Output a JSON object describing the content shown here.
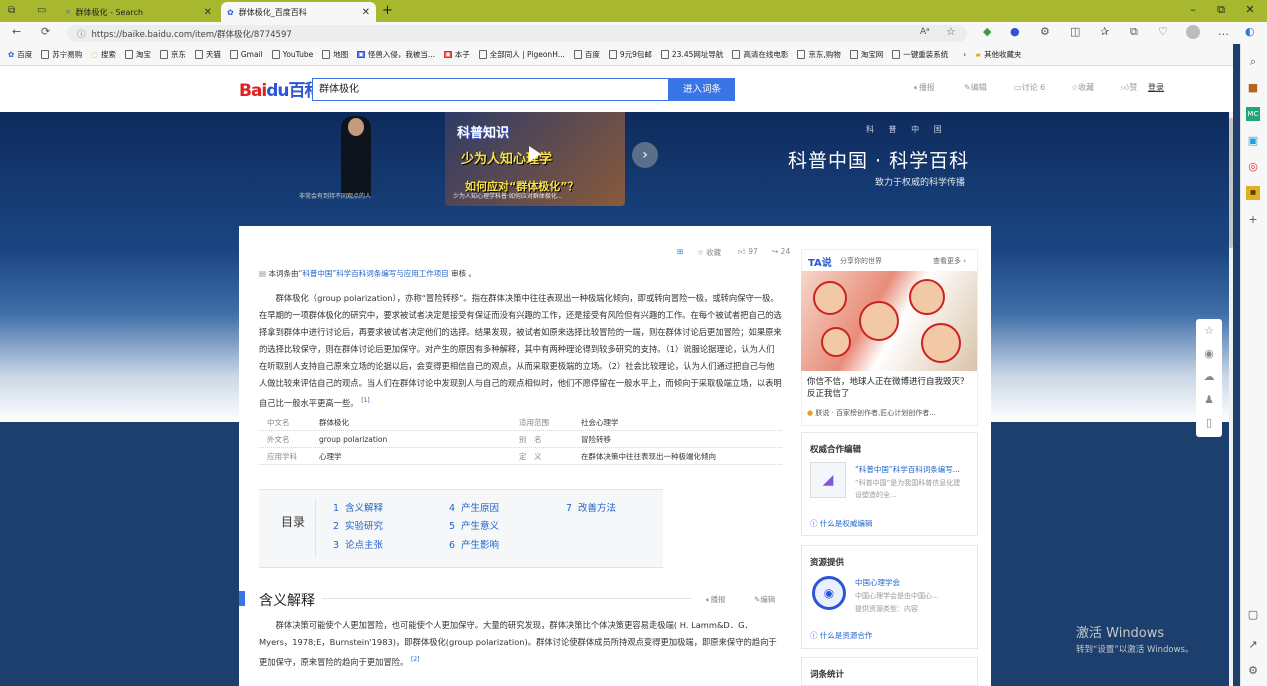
{
  "browser": {
    "tabs": [
      {
        "label": "群体极化 - Search",
        "active": false
      },
      {
        "label": "群体极化_百度百科",
        "active": true
      }
    ],
    "url": "https://baike.baidu.com/item/群体极化/8774597",
    "bookmarks": [
      "百度",
      "苏宁易购",
      "搜索",
      "淘宝",
      "京东",
      "天猫",
      "Gmail",
      "YouTube",
      "地图",
      "怪兽入侵，我被当...",
      "本子",
      "全部同人 | PigeonH...",
      "百度",
      "9元9包邮",
      "23.45网址导航",
      "高清在线电影",
      "京东,购物",
      "淘宝网",
      "一键重装系统"
    ],
    "bookmarks_more": "其他收藏夹"
  },
  "header": {
    "logo_bai": "Bai",
    "logo_du": "du百科",
    "search_value": "群体极化",
    "search_button": "进入词条",
    "actions": [
      "播报",
      "编辑",
      "讨论 6",
      "收藏",
      "赞"
    ],
    "login": "登录"
  },
  "banner": {
    "video1_caption": "非常会有到持不同观点的人",
    "video2_title1": "科普知识",
    "video2_title2": "少为人知心理学",
    "video2_title3": "如何应对“群体极化”？",
    "video2_caption": "少为人知心理学科普·如何应对群体极化...",
    "sci_logo": "科 普 中 国",
    "sci_title": "科普中国 · 科学百科",
    "sci_sub": "致力于权威的科学传播"
  },
  "article": {
    "stats": {
      "collect": "收藏",
      "likes": "97",
      "shares": "24"
    },
    "reviewer_prefix": "本词条由",
    "reviewer_link": "“科普中国”科学百科词条编写与应用工作项目",
    "reviewer_suffix": " 审核 。",
    "summary": "群体极化（group polarization），亦称“冒险转移”。指在群体决策中往往表现出一种极端化倾向，即或转向冒险一极，或转向保守一极。在早期的一项群体极化的研究中，要求被试者决定是接受有保证而没有兴趣的工作，还是接受有风险但有兴趣的工作。在每个被试者把自己的选择拿到群体中进行讨论后，再要求被试者决定他们的选择。结果发现，被试者如原来选择比较冒险的一端，则在群体讨论后更加冒险；如果原来的选择比较保守，则在群体讨论后更加保守。对产生的原因有多种解释，其中有两种理论得到较多研究的支持。（1）说服论据理论，认为人们在听取别人支持自己原来立场的论据以后，会变得更相信自己的观点，从而采取更极端的立场。（2）社会比较理论，认为人们通过把自己与他人做比较来评估自己的观点。当人们在群体讨论中发现别人与自己的观点相似时，他们不愿停留在一般水平上，而倾向于采取极端立场，以表明自己比一般水平更高一些。",
    "summary_ref": "[1]",
    "infobox": [
      {
        "k1": "中文名",
        "v1": "群体极化",
        "k2": "适用范围",
        "v2": "社会心理学"
      },
      {
        "k1": "外文名",
        "v1": "group polarization",
        "k2": "别　名",
        "v2": "冒险转移"
      },
      {
        "k1": "应用学科",
        "v1": "心理学",
        "k2": "定　义",
        "v2": "在群体决策中往往表现出一种极端化倾向"
      }
    ],
    "toc_title": "目录",
    "toc": [
      {
        "n": "1",
        "t": "含义解释"
      },
      {
        "n": "2",
        "t": "实验研究"
      },
      {
        "n": "3",
        "t": "论点主张"
      },
      {
        "n": "4",
        "t": "产生原因"
      },
      {
        "n": "5",
        "t": "产生意义"
      },
      {
        "n": "6",
        "t": "产生影响"
      },
      {
        "n": "7",
        "t": "改善方法"
      }
    ],
    "section_title": "含义解释",
    "section_actions": [
      "播报",
      "编辑"
    ],
    "section_text": "群体决策可能使个人更加冒险，也可能使个人更加保守。大量的研究发现，群体决策比个体决策更容易走极端( H. Lamm&D．G．Myers，1978;E，Burnstein'1983)，即群体极化(group polarization)。群体讨论使群体成员所持观点变得更加极端，即原来保守的趋向于更加保守，原来冒险的趋向于更加冒险。",
    "section_ref": "[2]"
  },
  "side": {
    "tashuo_logo": "TA说",
    "tashuo_tag": "分享你的世界",
    "tashuo_more": "查看更多 ›",
    "tashuo_headline": "你信不信，地球人正在微博进行自我毁灭？反正我信了",
    "tashuo_author": "朕说 · 百家榜创作者,匠心计划创作者...",
    "authority_title": "权威合作编辑",
    "authority_name": "“科普中国”科学百科词条编写...",
    "authority_desc": "“科普中国”是为我国科普信息化建设塑造的全...",
    "authority_help": "什么是权威编辑",
    "resource_title": "资源提供",
    "resource_name": "中国心理学会",
    "resource_desc": "中国心理学会是由中国心...",
    "resource_type": "提供资源类型：内容",
    "resource_help": "什么是资源合作",
    "stats_title": "词条统计"
  },
  "watermark": {
    "line1": "激活 Windows",
    "line2": "转到“设置”以激活 Windows。"
  }
}
